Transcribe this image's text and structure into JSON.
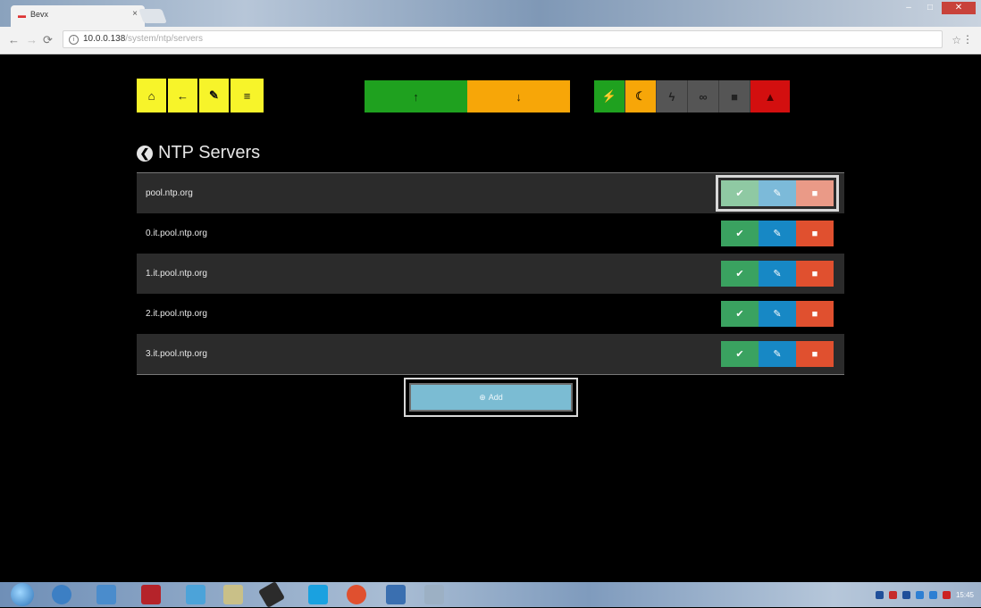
{
  "browser": {
    "tab_title": "Bevx",
    "tab_close": "×",
    "url_host": "10.0.0.138",
    "url_path": "/system/ntp/servers",
    "nav": {
      "back": "←",
      "forward": "→",
      "reload": "⟳"
    },
    "star": "☆",
    "menu": "⋮"
  },
  "toolbar": {
    "left": [
      {
        "name": "home-icon",
        "glyph": "⌂"
      },
      {
        "name": "back-arrow-icon",
        "glyph": "←"
      },
      {
        "name": "wrench-icon",
        "glyph": "✎"
      },
      {
        "name": "menu-icon",
        "glyph": "≡"
      }
    ],
    "middle": [
      {
        "name": "upload-icon",
        "glyph": "↑"
      },
      {
        "name": "download-icon",
        "glyph": "↓"
      }
    ],
    "right": [
      {
        "name": "plug-icon",
        "glyph": "⚡"
      },
      {
        "name": "moon-icon",
        "glyph": "☾"
      },
      {
        "name": "bolt-icon",
        "glyph": "ϟ"
      },
      {
        "name": "link-icon",
        "glyph": "∞"
      },
      {
        "name": "lock-icon",
        "glyph": "■"
      },
      {
        "name": "warning-icon",
        "glyph": "▲"
      }
    ],
    "colors": {
      "yellow": "#f7f42a",
      "green": "#1fa11f",
      "orange": "#f7a608",
      "gray": "#555555",
      "red": "#d30f0f"
    }
  },
  "page": {
    "title": "NTP Servers",
    "back_glyph": "❮"
  },
  "servers": [
    {
      "label": "pool.ntp.org"
    },
    {
      "label": "0.it.pool.ntp.org"
    },
    {
      "label": "1.it.pool.ntp.org"
    },
    {
      "label": "2.it.pool.ntp.org"
    },
    {
      "label": "3.it.pool.ntp.org"
    }
  ],
  "row_actions": {
    "check_glyph": "✔",
    "edit_glyph": "✎",
    "delete_glyph": "■"
  },
  "add": {
    "label": "Add",
    "glyph": "⊕"
  },
  "colors": {
    "check": "#3aa260",
    "edit": "#1788c5",
    "delete": "#e0502f",
    "add": "#7bbcd3"
  },
  "clock": {
    "time": "15:45"
  }
}
